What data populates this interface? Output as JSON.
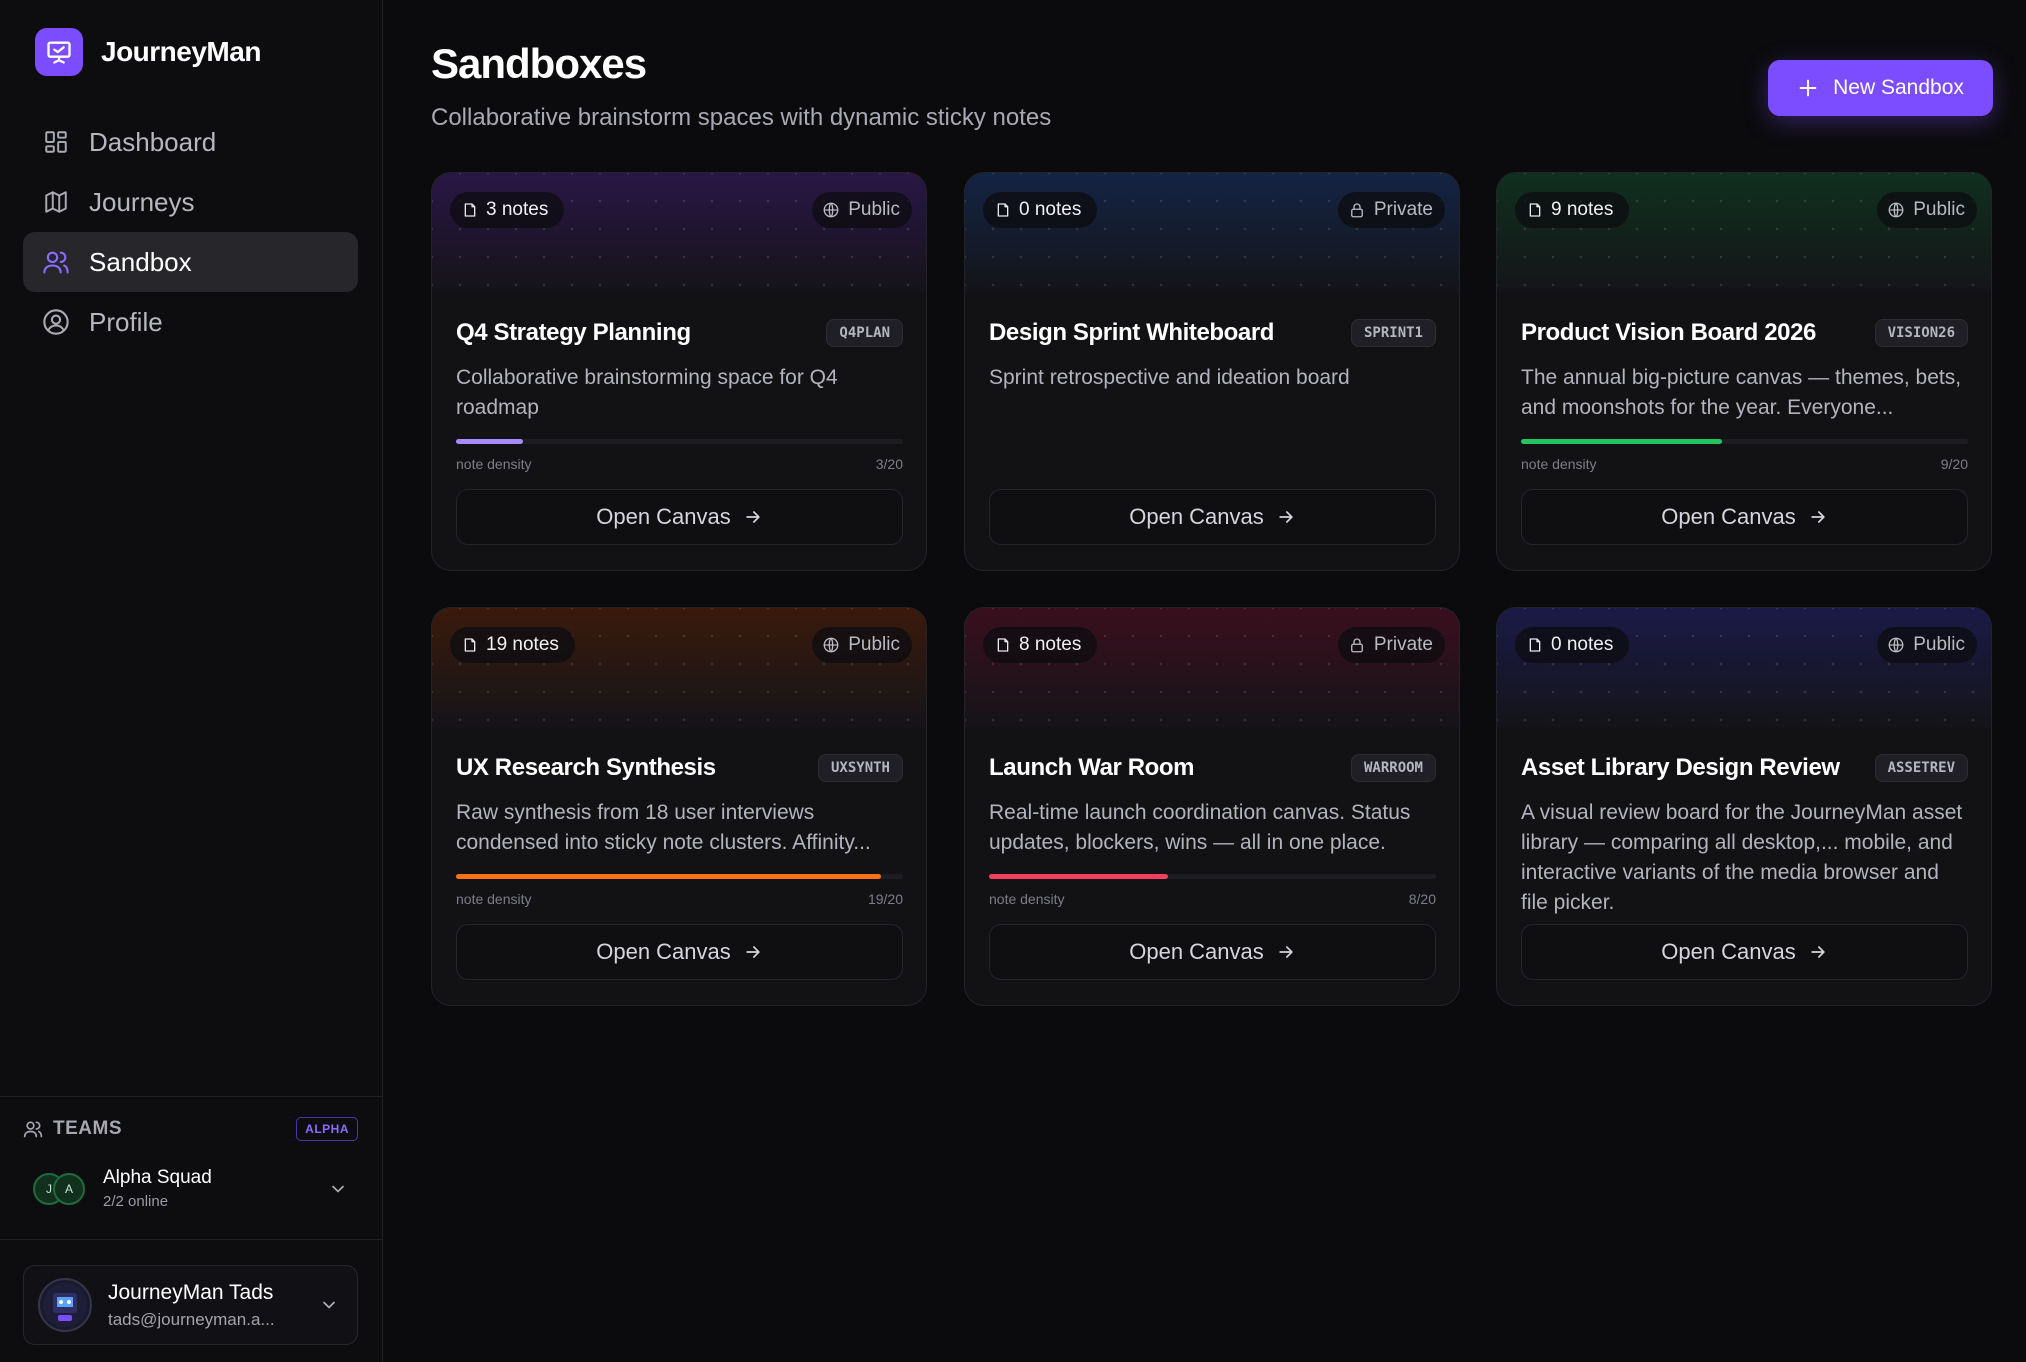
{
  "app": {
    "name": "JourneyMan"
  },
  "nav": [
    {
      "label": "Dashboard",
      "icon": "dashboard-icon",
      "active": false
    },
    {
      "label": "Journeys",
      "icon": "map-icon",
      "active": false
    },
    {
      "label": "Sandbox",
      "icon": "users-icon",
      "active": true
    },
    {
      "label": "Profile",
      "icon": "user-circle-icon",
      "active": false
    }
  ],
  "teams": {
    "heading": "TEAMS",
    "badge": "ALPHA",
    "team": {
      "name": "Alpha Squad",
      "status": "2/2 online",
      "avatars": [
        "J",
        "A"
      ]
    }
  },
  "user": {
    "name": "JourneyMan Tads",
    "email": "tads@journeyman.a..."
  },
  "page": {
    "title": "Sandboxes",
    "subtitle": "Collaborative brainstorm spaces with dynamic sticky notes",
    "new_button": "New Sandbox"
  },
  "cards": [
    {
      "notes": "3 notes",
      "visibility": "Public",
      "title": "Q4 Strategy Planning",
      "code": "Q4PLAN",
      "description": "Collaborative brainstorming space for Q4 roadmap",
      "density_label": "note density",
      "density_value": "3/20",
      "density": 0.15,
      "color": "#a78bfa",
      "banner": "#2a1646",
      "open_label": "Open Canvas"
    },
    {
      "notes": "0 notes",
      "visibility": "Private",
      "title": "Design Sprint Whiteboard",
      "code": "SPRINT1",
      "description": "Sprint retrospective and ideation board",
      "density_label": "",
      "density_value": "",
      "density": 0,
      "color": "#3b82f6",
      "banner": "#142444",
      "open_label": "Open Canvas"
    },
    {
      "notes": "9 notes",
      "visibility": "Public",
      "title": "Product Vision Board 2026",
      "code": "VISION26",
      "description": "The annual big-picture canvas — themes, bets, and moonshots for the year. Everyone...",
      "density_label": "note density",
      "density_value": "9/20",
      "density": 0.45,
      "color": "#22c55e",
      "banner": "#10301f",
      "open_label": "Open Canvas"
    },
    {
      "notes": "19 notes",
      "visibility": "Public",
      "title": "UX Research Synthesis",
      "code": "UXSYNTH",
      "description": "Raw synthesis from 18 user interviews condensed into sticky note clusters. Affinity...",
      "density_label": "note density",
      "density_value": "19/20",
      "density": 0.95,
      "color": "#f97316",
      "banner": "#3a1a0c",
      "open_label": "Open Canvas"
    },
    {
      "notes": "8 notes",
      "visibility": "Private",
      "title": "Launch War Room",
      "code": "WARROOM",
      "description": "Real-time launch coordination canvas. Status updates, blockers, wins — all in one place.",
      "density_label": "note density",
      "density_value": "8/20",
      "density": 0.4,
      "color": "#f43f5e",
      "banner": "#3a0f1d",
      "open_label": "Open Canvas"
    },
    {
      "notes": "0 notes",
      "visibility": "Public",
      "title": "Asset Library Design Review",
      "code": "ASSETREV",
      "description": "A visual review board for the JourneyMan asset library — comparing all desktop,... mobile, and interactive variants of the media browser and file picker.",
      "density_label": "",
      "density_value": "",
      "density": 0,
      "color": "#6366f1",
      "banner": "#1b1a48",
      "open_label": "Open Canvas"
    }
  ]
}
